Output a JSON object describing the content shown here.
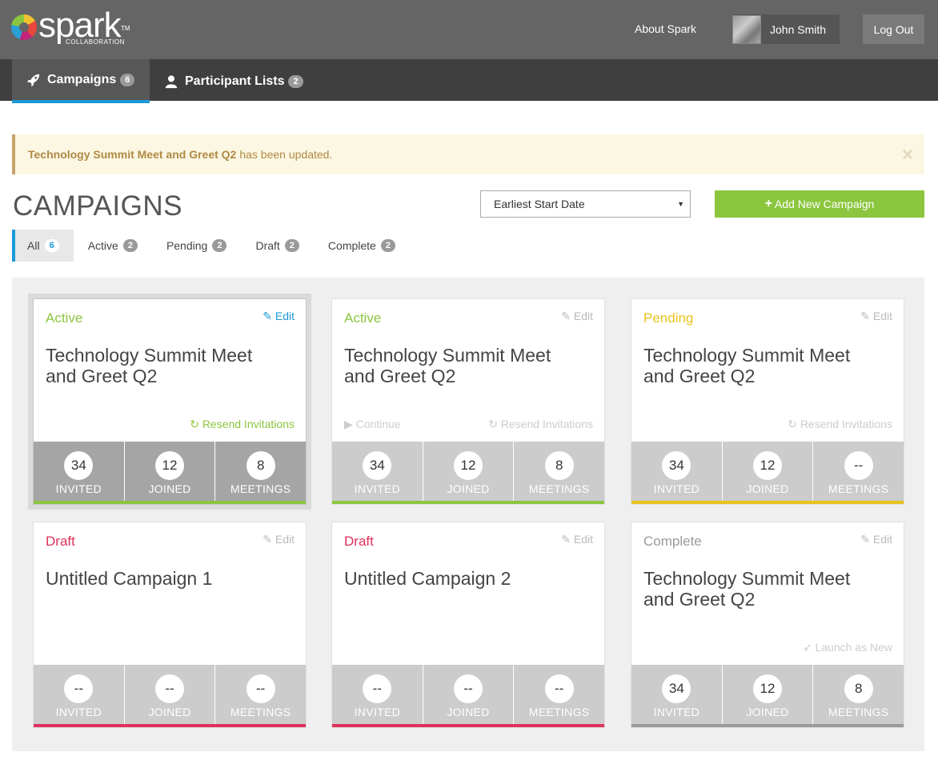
{
  "header": {
    "logo_text": "spark",
    "logo_tm": "TM",
    "logo_sub": "COLLABORATION",
    "about_label": "About Spark",
    "user_name": "John Smith",
    "logout_label": "Log Out"
  },
  "nav": {
    "tabs": [
      {
        "label": "Campaigns",
        "count": "6",
        "icon": "rocket-icon",
        "active": true
      },
      {
        "label": "Participant Lists",
        "count": "2",
        "icon": "user-icon",
        "active": false
      }
    ]
  },
  "alert": {
    "bold": "Technology Summit Meet and Greet Q2",
    "text": "has been updated.",
    "close": "×"
  },
  "page": {
    "title": "CAMPAIGNS",
    "sort_value": "Earliest Start Date",
    "add_label": "Add New Campaign"
  },
  "filters": [
    {
      "label": "All",
      "count": "6"
    },
    {
      "label": "Active",
      "count": "2"
    },
    {
      "label": "Pending",
      "count": "2"
    },
    {
      "label": "Draft",
      "count": "2"
    },
    {
      "label": "Complete",
      "count": "2"
    }
  ],
  "stat_labels": {
    "invited": "INVITED",
    "joined": "JOINED",
    "meetings": "MEETINGS"
  },
  "edit_label": "Edit",
  "cards": [
    {
      "status": "Active",
      "title": "Technology Summit Meet and Greet Q2",
      "left_action": "",
      "right_action": "Resend Invitations",
      "invited": "34",
      "joined": "12",
      "meetings": "8"
    },
    {
      "status": "Active",
      "title": "Technology Summit Meet and Greet Q2",
      "left_action": "Continue",
      "right_action": "Resend Invitations",
      "invited": "34",
      "joined": "12",
      "meetings": "8"
    },
    {
      "status": "Pending",
      "title": "Technology Summit Meet and Greet Q2",
      "left_action": "",
      "right_action": "Resend Invitations",
      "invited": "34",
      "joined": "12",
      "meetings": "--"
    },
    {
      "status": "Draft",
      "title": "Untitled Campaign 1",
      "left_action": "",
      "right_action": "",
      "invited": "--",
      "joined": "--",
      "meetings": "--"
    },
    {
      "status": "Draft",
      "title": "Untitled Campaign 2",
      "left_action": "",
      "right_action": "",
      "invited": "--",
      "joined": "--",
      "meetings": "--"
    },
    {
      "status": "Complete",
      "title": "Technology Summit Meet and Greet Q2",
      "left_action": "",
      "right_action": "Launch as New",
      "invited": "34",
      "joined": "12",
      "meetings": "8"
    }
  ],
  "colors": {
    "active": "#8cc63f",
    "pending": "#e8c21e",
    "draft": "#e0315b",
    "complete": "#9a9a9a",
    "accent": "#1c9ad6"
  }
}
